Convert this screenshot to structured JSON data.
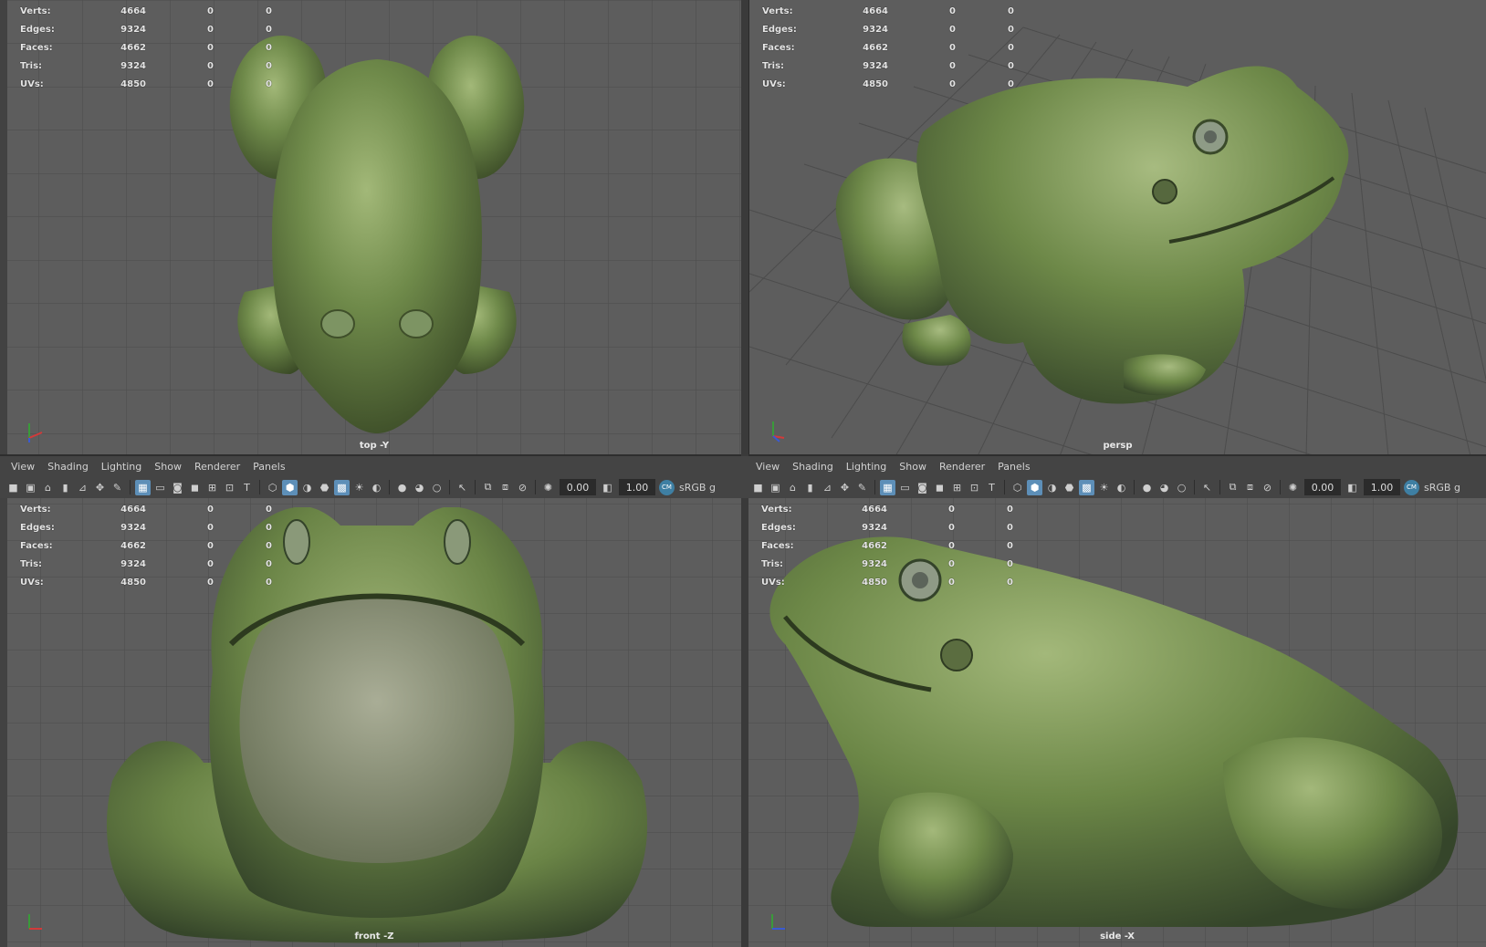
{
  "stats": [
    {
      "label": "Verts:",
      "v1": "4664",
      "v2": "0",
      "v3": "0"
    },
    {
      "label": "Edges:",
      "v1": "9324",
      "v2": "0",
      "v3": "0"
    },
    {
      "label": "Faces:",
      "v1": "4662",
      "v2": "0",
      "v3": "0"
    },
    {
      "label": "Tris:",
      "v1": "9324",
      "v2": "0",
      "v3": "0"
    },
    {
      "label": "UVs:",
      "v1": "4850",
      "v2": "0",
      "v3": "0"
    }
  ],
  "viewports": {
    "top": {
      "camera": "top -Y"
    },
    "persp": {
      "camera": "persp"
    },
    "front": {
      "camera": "front -Z"
    },
    "side": {
      "camera": "side -X"
    }
  },
  "panel_menu": [
    "View",
    "Shading",
    "Lighting",
    "Show",
    "Renderer",
    "Panels"
  ],
  "toolbar": {
    "exposure": "0.00",
    "gamma": "1.00",
    "color_space": "sRGB g",
    "badge": "CM"
  },
  "colors": {
    "viewport_bg": "#5d5d5d",
    "grid_line": "#4a4a4a",
    "frog_green": "#6f8a4a",
    "highlight_blue": "#5d8fb8"
  },
  "icons": [
    "camera-icon",
    "camera-attributes-icon",
    "bookmark-icon",
    "image-plane-icon",
    "grid-icon",
    "film-gate-icon",
    "resolution-gate-icon",
    "wireframe-icon",
    "smooth-shade-icon",
    "textured-icon",
    "lighting-icon",
    "shadows-icon",
    "xray-icon",
    "isolate-icon",
    "exposure-icon",
    "gamma-icon",
    "color-management-icon"
  ]
}
